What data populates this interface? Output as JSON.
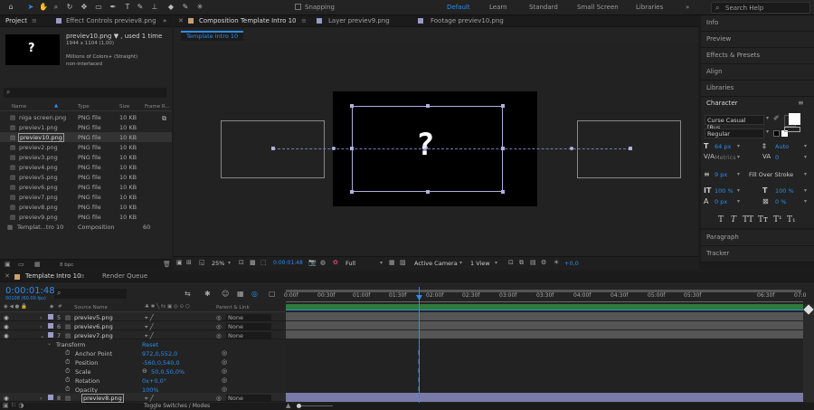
{
  "toolbar": {
    "snapping_label": "Snapping",
    "workspaces": [
      {
        "label": "Default",
        "active": true
      },
      {
        "label": "Learn",
        "active": false
      },
      {
        "label": "Standard",
        "active": false
      },
      {
        "label": "Small Screen",
        "active": false
      },
      {
        "label": "Libraries",
        "active": false
      }
    ],
    "search_placeholder": "Search Help"
  },
  "project_panel": {
    "tab_project": "Project",
    "tab_effect_controls": "Effect Controls previev8.png",
    "preview": {
      "name": "previev10.png ▼ , used 1 time",
      "dims": "1944 x 1104 (1,00)",
      "colors": "Millions of Colors+ (Straight)",
      "interlace": "non-interlaced"
    },
    "search_placeholder": "",
    "columns": {
      "name": "Name",
      "type": "Type",
      "size": "Size",
      "frame_rate": "Frame R..."
    },
    "items": [
      {
        "name": "niga screen.png",
        "type": "PNG file",
        "size": "10 KB",
        "rate": ""
      },
      {
        "name": "previev1.png",
        "type": "PNG file",
        "size": "10 KB",
        "rate": ""
      },
      {
        "name": "previev10.png",
        "type": "PNG file",
        "size": "10 KB",
        "rate": ""
      },
      {
        "name": "previev2.png",
        "type": "PNG file",
        "size": "10 KB",
        "rate": ""
      },
      {
        "name": "previev3.png",
        "type": "PNG file",
        "size": "10 KB",
        "rate": ""
      },
      {
        "name": "previev4.png",
        "type": "PNG file",
        "size": "10 KB",
        "rate": ""
      },
      {
        "name": "previev5.png",
        "type": "PNG file",
        "size": "10 KB",
        "rate": ""
      },
      {
        "name": "previev6.png",
        "type": "PNG file",
        "size": "10 KB",
        "rate": ""
      },
      {
        "name": "previev7.png",
        "type": "PNG file",
        "size": "10 KB",
        "rate": ""
      },
      {
        "name": "previev8.png",
        "type": "PNG file",
        "size": "10 KB",
        "rate": ""
      },
      {
        "name": "previev9.png",
        "type": "PNG file",
        "size": "10 KB",
        "rate": ""
      },
      {
        "name": "Templat...tro 10",
        "type": "Composition",
        "size": "",
        "rate": "60"
      }
    ],
    "bpc_label": "8 bpc"
  },
  "composition": {
    "tab_composition": "Composition Template Intro 10",
    "tab_layer": "Layer  previev9.png",
    "tab_footage": "Footage  previev10.png",
    "subtab": "Template Intro 10",
    "glyph": "?",
    "zoom": "25%",
    "timecode": "0:00:01:48",
    "resolution": "Full",
    "camera": "Active Camera",
    "view": "1 View",
    "exposure": "+0,0"
  },
  "right_panels": {
    "items": [
      "Info",
      "Preview",
      "Effects & Presets",
      "Align",
      "Libraries"
    ],
    "character_title": "Character",
    "font_name": "Curse Casual [Rus...",
    "font_style": "Regular",
    "font_size": "64 px",
    "leading": "Auto",
    "kerning": "Metrics",
    "tracking": "0",
    "stroke_width": "9 px",
    "stroke_type": "Fill Over Stroke",
    "vert_scale": "100 %",
    "horiz_scale": "100 %",
    "baseline": "0 px",
    "tsume": "0 %",
    "paragraph": "Paragraph",
    "tracker": "Tracker"
  },
  "timeline": {
    "tab_comp": "Template Intro 10",
    "tab_render": "Render Queue",
    "timecode": "0:00:01:48",
    "subtime": "00108 (60.00 fps)",
    "search_placeholder": "",
    "col_source": "Source Name",
    "col_parent": "Parent & Link",
    "layers": [
      {
        "num": "5",
        "name": "previev5.png",
        "parent": "None"
      },
      {
        "num": "6",
        "name": "previev6.png",
        "parent": "None"
      },
      {
        "num": "7",
        "name": "previev7.png",
        "parent": "None"
      }
    ],
    "transform": {
      "label": "Transform",
      "reset": "Reset",
      "props": [
        {
          "name": "Anchor Point",
          "value": "972,0,552,0"
        },
        {
          "name": "Position",
          "value": "-560,0,540,0"
        },
        {
          "name": "Scale",
          "value": "50,0,50,0%"
        },
        {
          "name": "Rotation",
          "value": "0x+0,0°"
        },
        {
          "name": "Opacity",
          "value": "100%"
        }
      ]
    },
    "layer8": {
      "num": "8",
      "name": "previev8.png",
      "parent": "None"
    },
    "ruler": [
      "0:00f",
      "00:30f",
      "01:00f",
      "01:30f",
      "02:00f",
      "02:30f",
      "03:00f",
      "03:30f",
      "04:00f",
      "04:30f",
      "05:00f",
      "05:30f",
      "06:30f",
      "07:0"
    ],
    "toggle_label": "Toggle Switches / Modes",
    "colors": {
      "accent": "#2d8ceb",
      "layer_bar": "#9a9ac8",
      "work_area": "#2e7a3a"
    }
  }
}
